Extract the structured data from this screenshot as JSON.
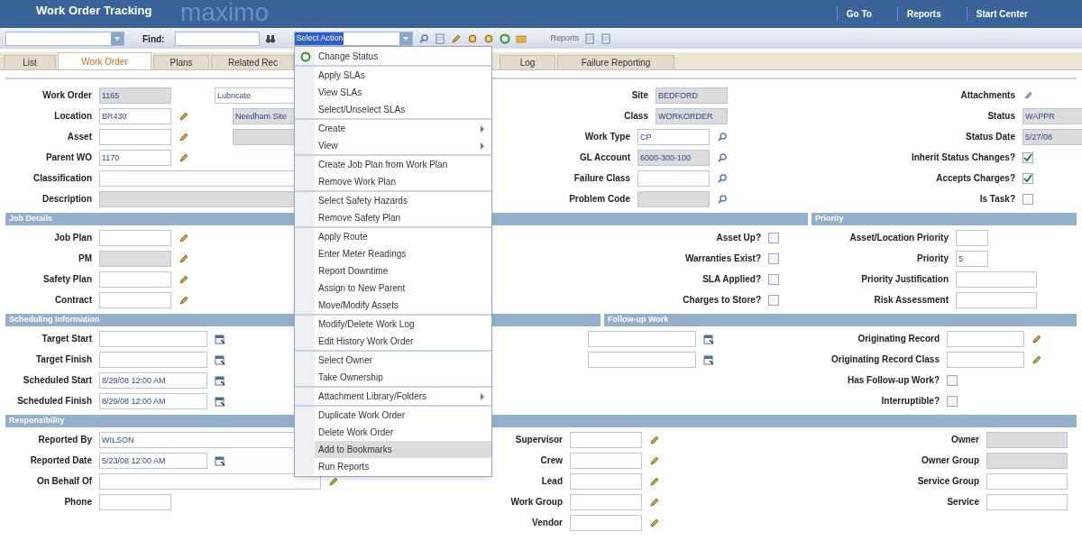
{
  "app_title": "Work Order Tracking",
  "logo": "maximo",
  "top_links": [
    "Go To",
    "Reports",
    "Start Center"
  ],
  "toolbar": {
    "find_label": "Find:",
    "action_select": "Select Action",
    "reports_link": "Reports"
  },
  "tabs": [
    {
      "label": "List",
      "selected": false
    },
    {
      "label": "Work Order",
      "selected": true
    },
    {
      "label": "Plans",
      "selected": false
    },
    {
      "label": "Related Rec",
      "selected": false
    },
    {
      "label": "Log",
      "selected": false
    },
    {
      "label": "Failure Reporting",
      "selected": false
    }
  ],
  "sections": [
    {
      "columns": [
        [
          {
            "label": "Work Order",
            "kind": "text",
            "value": "1165",
            "readonly": true,
            "desc": "Lubricate",
            "desc_readonly": false
          },
          {
            "label": "Location",
            "kind": "lookup",
            "value": "BR430",
            "readonly": false,
            "desc": "Needham Site",
            "desc_readonly": true
          },
          {
            "label": "Asset",
            "kind": "lookup",
            "readonly": false,
            "desc_readonly": true
          },
          {
            "label": "Parent WO",
            "kind": "lookup",
            "value": "1170",
            "readonly": false
          },
          {
            "label": "Classification",
            "kind": "long",
            "readonly": false
          },
          {
            "label": "Description",
            "kind": "long",
            "readonly": true
          }
        ],
        [
          {
            "label": "Site",
            "kind": "text",
            "value": "BEDFORD",
            "readonly": true
          },
          {
            "label": "Class",
            "kind": "text",
            "value": "WORKORDER",
            "readonly": true
          },
          {
            "label": "Work Type",
            "kind": "lookup",
            "value": "CP",
            "readonly": false
          },
          {
            "label": "GL Account",
            "kind": "lookup",
            "value": "6000-300-100",
            "readonly": true
          },
          {
            "label": "Failure Class",
            "kind": "lookup",
            "readonly": false
          },
          {
            "label": "Problem Code",
            "kind": "lookup",
            "readonly": true
          }
        ],
        [
          {
            "label": "Attachments",
            "kind": "attach"
          },
          {
            "label": "Status",
            "kind": "text",
            "value": "WAPPR",
            "readonly": true
          },
          {
            "label": "Status Date",
            "kind": "text",
            "value": "5/27/08",
            "readonly": true
          },
          {
            "label": "Inherit Status Changes?",
            "kind": "check",
            "checked": true
          },
          {
            "label": "Accepts Charges?",
            "kind": "check",
            "checked": true
          },
          {
            "label": "Is Task?",
            "kind": "check",
            "checked": false
          }
        ]
      ]
    },
    {
      "bars": [
        "Job Details",
        "Priority"
      ],
      "columns": [
        [
          {
            "label": "Job Plan",
            "kind": "lookup",
            "readonly": false
          },
          {
            "label": "PM",
            "kind": "lookup",
            "readonly": true
          },
          {
            "label": "Safety Plan",
            "kind": "lookup",
            "readonly": false
          },
          {
            "label": "Contract",
            "kind": "lookup",
            "readonly": false
          }
        ],
        [
          {
            "label": "Asset Up?",
            "kind": "check",
            "checked": false
          },
          {
            "label": "Warranties Exist?",
            "kind": "check",
            "checked": false
          },
          {
            "label": "SLA Applied?",
            "kind": "check",
            "checked": false
          },
          {
            "label": "Charges to Store?",
            "kind": "check",
            "checked": false
          }
        ],
        [
          {
            "label": "Asset/Location Priority",
            "kind": "short",
            "readonly": false
          },
          {
            "label": "Priority",
            "kind": "short",
            "value": "5",
            "readonly": false
          },
          {
            "label": "Priority Justification",
            "kind": "text",
            "readonly": false
          },
          {
            "label": "Risk Assessment",
            "kind": "text",
            "readonly": false
          }
        ]
      ]
    },
    {
      "bars": [
        "Scheduling Information",
        "Follow-up Work"
      ],
      "columns": [
        [
          {
            "label": "Target Start",
            "kind": "date",
            "readonly": false
          },
          {
            "label": "Target Finish",
            "kind": "date",
            "readonly": false
          },
          {
            "label": "Scheduled Start",
            "kind": "date",
            "value": "8/29/08 12:00 AM",
            "readonly": false
          },
          {
            "label": "Scheduled Finish",
            "kind": "date",
            "value": "8/29/08 12:00 AM",
            "readonly": false
          }
        ],
        [
          {
            "kind": "date",
            "readonly": false
          },
          {
            "kind": "date",
            "readonly": false
          }
        ],
        [
          {
            "label": "Originating Record",
            "kind": "lookup",
            "readonly": false
          },
          {
            "label": "Originating Record Class",
            "kind": "lookup",
            "readonly": false
          },
          {
            "label": "Has Follow-up Work?",
            "kind": "check",
            "checked": false
          },
          {
            "label": "Interruptible?",
            "kind": "check",
            "checked": false
          }
        ]
      ]
    },
    {
      "bars": [
        "Responsibility"
      ],
      "columns": [
        [
          {
            "label": "Reported By",
            "kind": "long",
            "value": "WILSON",
            "readonly": false
          },
          {
            "label": "Reported Date",
            "kind": "date",
            "value": "5/23/08 12:00 AM",
            "readonly": false
          },
          {
            "label": "On Behalf Of",
            "kind": "longlookup",
            "readonly": false
          },
          {
            "label": "Phone",
            "kind": "text",
            "readonly": false
          }
        ],
        [
          {
            "label": "Supervisor",
            "kind": "lookup",
            "readonly": false
          },
          {
            "label": "Crew",
            "kind": "lookup",
            "readonly": false
          },
          {
            "label": "Lead",
            "kind": "lookup",
            "readonly": false
          },
          {
            "label": "Work Group",
            "kind": "lookup",
            "readonly": false
          },
          {
            "label": "Vendor",
            "kind": "lookup",
            "readonly": false
          }
        ],
        [
          {
            "label": "Owner",
            "kind": "text",
            "readonly": true
          },
          {
            "label": "Owner Group",
            "kind": "text",
            "readonly": true
          },
          {
            "label": "Service Group",
            "kind": "text",
            "readonly": false
          },
          {
            "label": "Service",
            "kind": "text",
            "readonly": false
          }
        ]
      ]
    }
  ],
  "action_menu": {
    "groups": [
      [
        {
          "label": "Change Status",
          "submenu": false,
          "selected": false,
          "kind": "status"
        }
      ],
      [
        {
          "label": "Apply SLAs",
          "submenu": false,
          "selected": false
        },
        {
          "label": "View SLAs",
          "submenu": false,
          "selected": false
        },
        {
          "label": "Select/Unselect SLAs",
          "submenu": false,
          "selected": false
        }
      ],
      [
        {
          "label": "Create",
          "submenu": true,
          "selected": false
        },
        {
          "label": "View",
          "submenu": true,
          "selected": false
        }
      ],
      [
        {
          "label": "Create Job Plan from Work Plan",
          "submenu": false,
          "selected": false
        },
        {
          "label": "Remove Work Plan",
          "submenu": false,
          "selected": false
        }
      ],
      [
        {
          "label": "Select Safety Hazards",
          "submenu": false,
          "selected": false
        },
        {
          "label": "Remove Safety Plan",
          "submenu": false,
          "selected": false
        }
      ],
      [
        {
          "label": "Apply Route",
          "submenu": false,
          "selected": false
        },
        {
          "label": "Enter Meter Readings",
          "submenu": false,
          "selected": false
        },
        {
          "label": "Report Downtime",
          "submenu": false,
          "selected": false
        },
        {
          "label": "Assign to New Parent",
          "submenu": false,
          "selected": false
        },
        {
          "label": "Move/Modify Assets",
          "submenu": false,
          "selected": false
        }
      ],
      [
        {
          "label": "Modify/Delete Work Log",
          "submenu": false,
          "selected": false
        },
        {
          "label": "Edit History Work Order",
          "submenu": false,
          "selected": false
        }
      ],
      [
        {
          "label": "Select Owner",
          "submenu": false,
          "selected": false
        },
        {
          "label": "Take Ownership",
          "submenu": false,
          "selected": false
        }
      ],
      [
        {
          "label": "Attachment Library/Folders",
          "submenu": true,
          "selected": false
        }
      ],
      [
        {
          "label": "Duplicate Work Order",
          "submenu": false,
          "selected": false
        },
        {
          "label": "Delete Work Order",
          "submenu": false,
          "selected": false
        },
        {
          "label": "Add to Bookmarks",
          "submenu": false,
          "selected": true
        },
        {
          "label": "Run Reports",
          "submenu": false,
          "selected": false
        }
      ]
    ]
  }
}
